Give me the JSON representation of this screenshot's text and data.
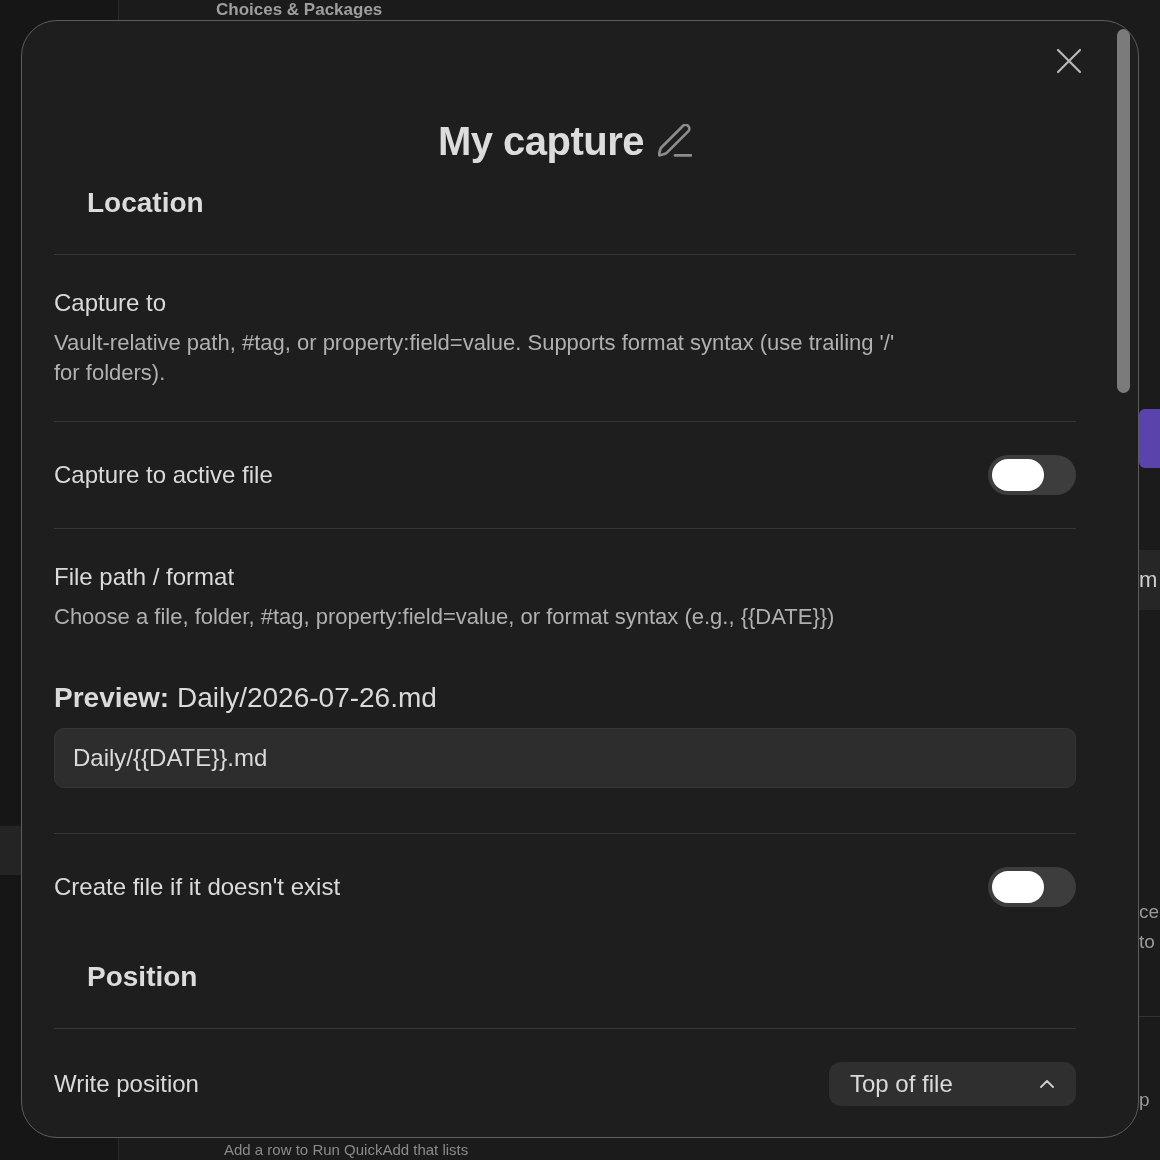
{
  "background": {
    "heading": "Choices & Packages",
    "row_fragment": "m",
    "description_fragments": [
      "ce",
      "to"
    ],
    "trailing_fragment": "p",
    "footer_text": "Add a row to Run QuickAdd that lists"
  },
  "modal": {
    "title": "My capture",
    "sections": [
      {
        "heading": "Location",
        "settings": [
          {
            "kind": "info",
            "name": "Capture to",
            "description": "Vault-relative path, #tag, or property:field=value. Supports format syntax (use trailing '/' for folders)."
          },
          {
            "kind": "toggle",
            "name": "Capture to active file",
            "on": false
          },
          {
            "kind": "path",
            "name": "File path / format",
            "description": "Choose a file, folder, #tag, property:field=value, or format syntax (e.g., {{DATE}})",
            "preview": "**Preview:** Daily/2026-07-26.md",
            "value": "Daily/{{DATE}}.md"
          },
          {
            "kind": "toggle",
            "name": "Create file if it doesn't exist",
            "on": false
          }
        ]
      },
      {
        "heading": "Position",
        "settings": [
          {
            "kind": "dropdown",
            "name": "Write position",
            "value": "Top of file"
          }
        ]
      }
    ]
  }
}
